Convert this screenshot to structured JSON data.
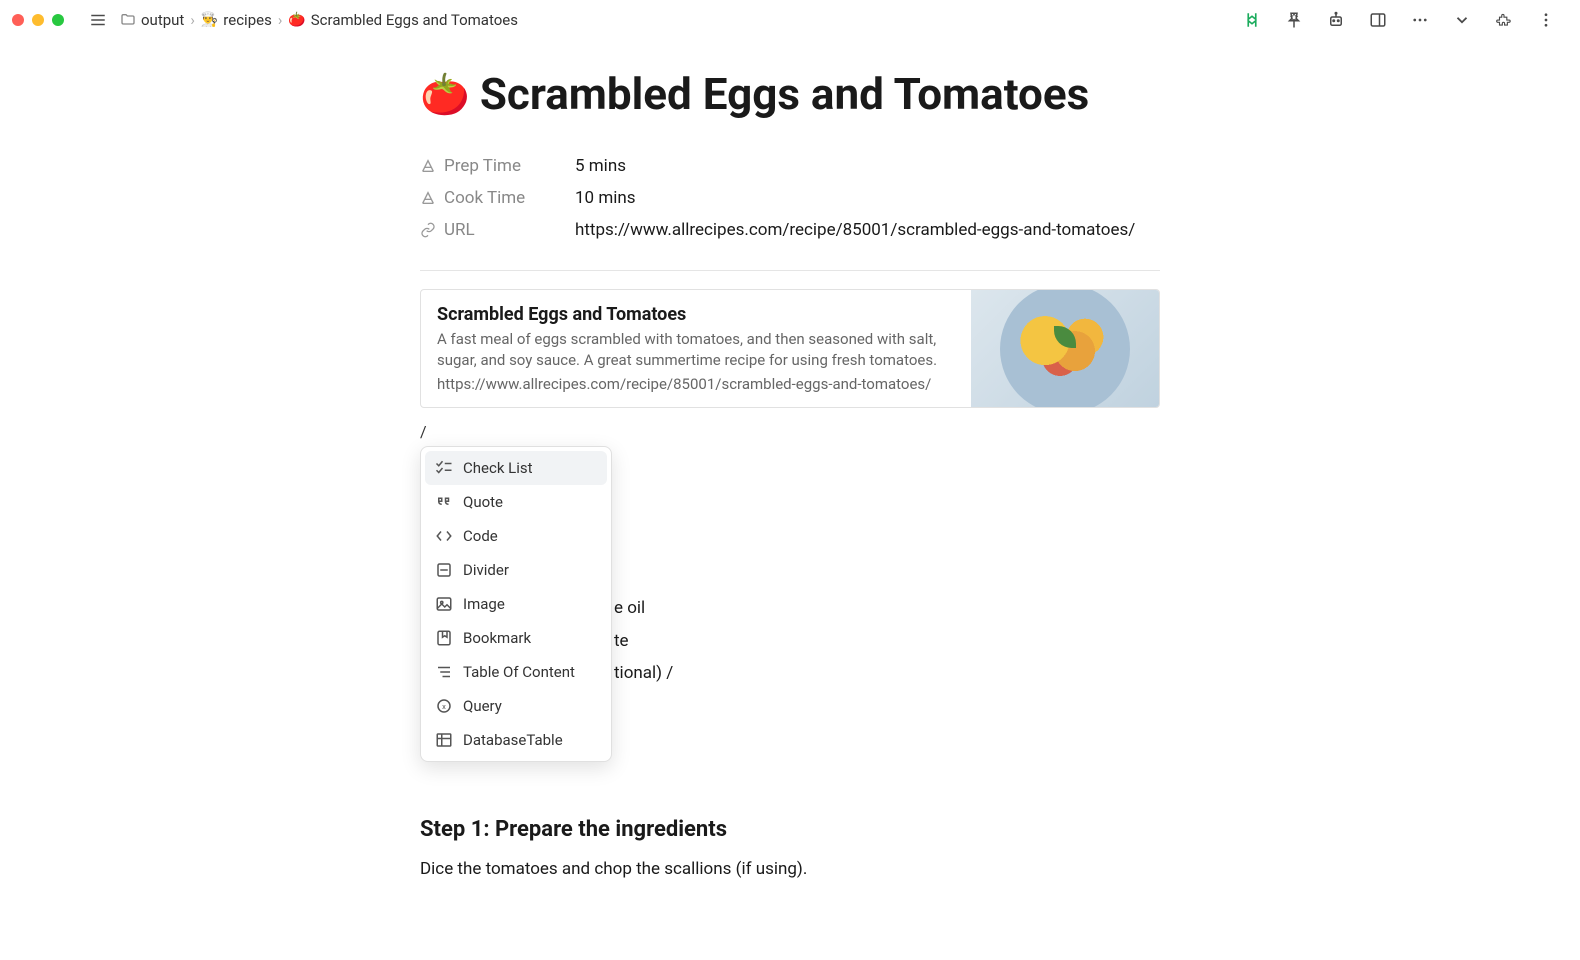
{
  "breadcrumb": {
    "root_icon": "folder",
    "root": "output",
    "level2_emoji": "👨‍🍳",
    "level2": "recipes",
    "leaf_emoji": "🍅",
    "leaf": "Scrambled Eggs and Tomatoes"
  },
  "page": {
    "emoji": "🍅",
    "title": "Scrambled Eggs and Tomatoes"
  },
  "props": {
    "prep_time_label": "Prep Time",
    "prep_time_value": "5 mins",
    "cook_time_label": "Cook Time",
    "cook_time_value": "10 mins",
    "url_label": "URL",
    "url_value": "https://www.allrecipes.com/recipe/85001/scrambled-eggs-and-tomatoes/"
  },
  "bookmark": {
    "title": "Scrambled Eggs and Tomatoes",
    "desc": "A fast meal of eggs scrambled with tomatoes, and then seasoned with salt, sugar, and soy sauce. A great summertime recipe for using fresh tomatoes.",
    "url": "https://www.allrecipes.com/recipe/85001/scrambled-eggs-and-tomatoes/"
  },
  "slash": {
    "trigger": "/",
    "items": [
      "Check List",
      "Quote",
      "Code",
      "Divider",
      "Image",
      "Bookmark",
      "Table Of Content",
      "Query",
      "DatabaseTable"
    ]
  },
  "behind_fragments": {
    "f1": "e oil",
    "f2": "te",
    "f3": "tional) /"
  },
  "step1": {
    "heading": "Step 1: Prepare the ingredients",
    "body": "Dice the tomatoes and chop the scallions (if using)."
  }
}
